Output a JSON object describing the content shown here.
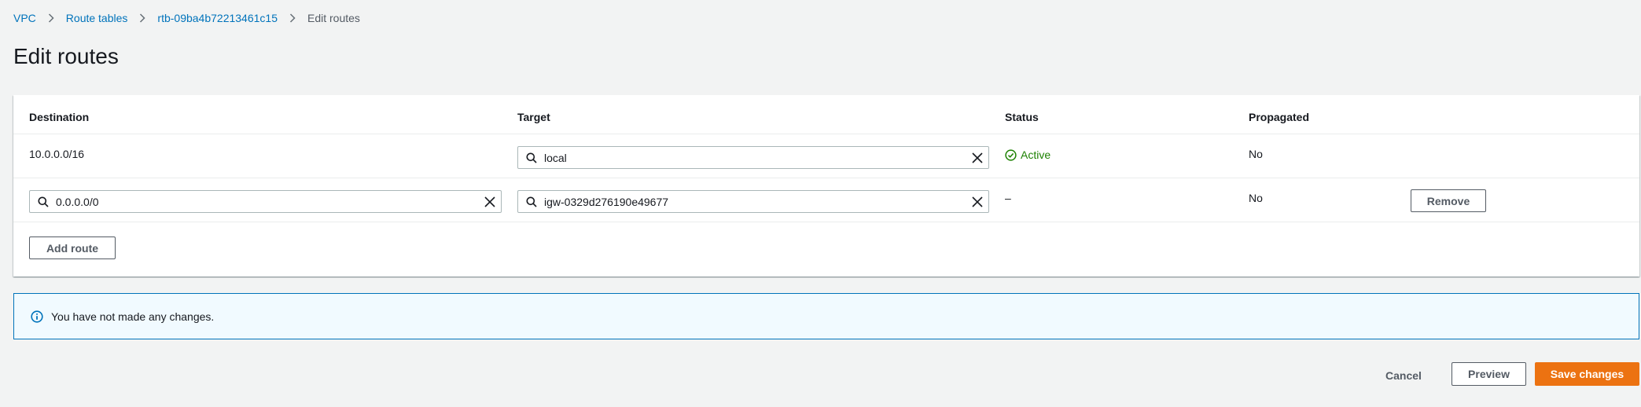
{
  "breadcrumb": {
    "items": [
      "VPC",
      "Route tables",
      "rtb-09ba4b72213461c15"
    ],
    "current": "Edit routes"
  },
  "page": {
    "title": "Edit routes"
  },
  "table": {
    "headers": {
      "destination": "Destination",
      "target": "Target",
      "status": "Status",
      "propagated": "Propagated"
    },
    "rows": [
      {
        "destination": "10.0.0.0/16",
        "target": "local",
        "status": "Active",
        "propagated": "No"
      },
      {
        "destination": "0.0.0.0/0",
        "target": "igw-0329d276190e49677",
        "status": "–",
        "propagated": "No",
        "remove_label": "Remove"
      }
    ],
    "add_route_label": "Add route"
  },
  "info": {
    "message": "You have not made any changes."
  },
  "footer": {
    "cancel_label": "Cancel",
    "preview_label": "Preview",
    "save_label": "Save changes"
  },
  "colors": {
    "link": "#0073bb",
    "success": "#1d8102",
    "primary": "#ec7211",
    "info_border": "#0073bb",
    "info_bg": "#f1faff"
  },
  "icons": {
    "separator": "chevron-right-icon",
    "search": "search-icon",
    "clear": "close-icon",
    "status": "check-circle-icon",
    "info": "info-icon"
  }
}
